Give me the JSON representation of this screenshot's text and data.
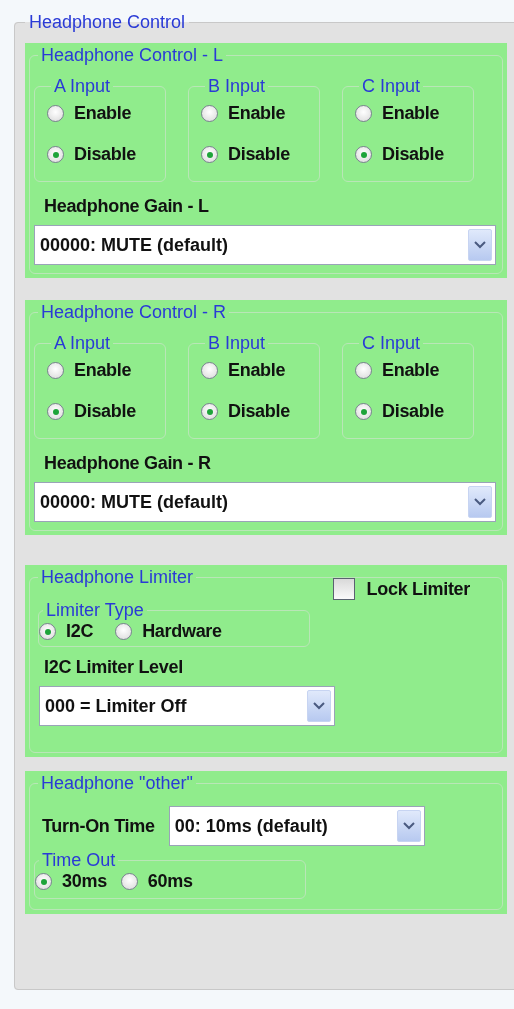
{
  "group_title": "Headphone Control",
  "channels": [
    {
      "title": "Headphone Control - L",
      "inputs": [
        {
          "title": "A Input",
          "options": [
            {
              "label": "Enable",
              "selected": false
            },
            {
              "label": "Disable",
              "selected": true
            }
          ]
        },
        {
          "title": "B Input",
          "options": [
            {
              "label": "Enable",
              "selected": false
            },
            {
              "label": "Disable",
              "selected": true
            }
          ]
        },
        {
          "title": "C Input",
          "options": [
            {
              "label": "Enable",
              "selected": false
            },
            {
              "label": "Disable",
              "selected": true
            }
          ]
        }
      ],
      "gain_label": "Headphone Gain - L",
      "gain_value": "00000: MUTE (default)"
    },
    {
      "title": "Headphone Control - R",
      "inputs": [
        {
          "title": "A Input",
          "options": [
            {
              "label": "Enable",
              "selected": false
            },
            {
              "label": "Disable",
              "selected": true
            }
          ]
        },
        {
          "title": "B Input",
          "options": [
            {
              "label": "Enable",
              "selected": false
            },
            {
              "label": "Disable",
              "selected": true
            }
          ]
        },
        {
          "title": "C Input",
          "options": [
            {
              "label": "Enable",
              "selected": false
            },
            {
              "label": "Disable",
              "selected": true
            }
          ]
        }
      ],
      "gain_label": "Headphone Gain - R",
      "gain_value": "00000: MUTE (default)"
    }
  ],
  "limiter": {
    "title": "Headphone Limiter",
    "lock": {
      "label": "Lock Limiter",
      "checked": false
    },
    "type": {
      "title": "Limiter Type",
      "options": [
        {
          "label": "I2C",
          "selected": true
        },
        {
          "label": "Hardware",
          "selected": false
        }
      ]
    },
    "level_label": "I2C Limiter Level",
    "level_value": "000 = Limiter Off"
  },
  "other": {
    "title": "Headphone \"other\"",
    "turn_on_label": "Turn-On Time",
    "turn_on_value": "00: 10ms (default)",
    "timeout": {
      "title": "Time Out",
      "options": [
        {
          "label": "30ms",
          "selected": true
        },
        {
          "label": "60ms",
          "selected": false
        }
      ]
    }
  }
}
